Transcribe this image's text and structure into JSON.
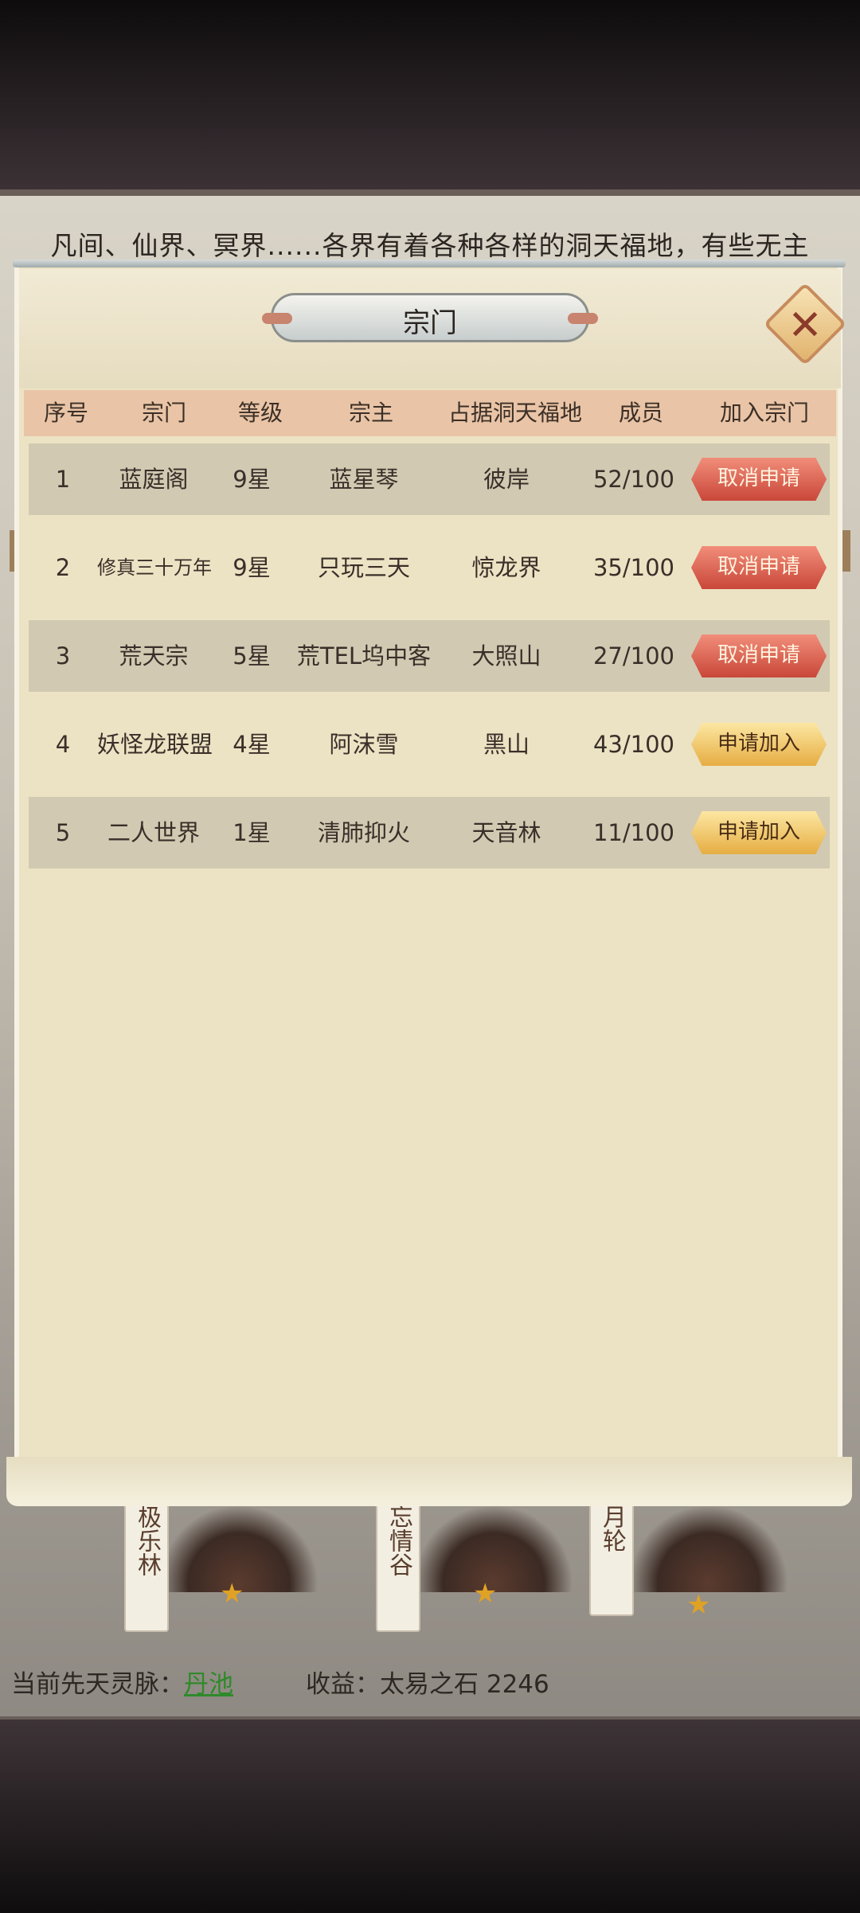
{
  "intro_text": "凡间、仙界、冥界......各界有着各种各样的洞天福地，有些无主",
  "dialog": {
    "title": "宗门",
    "close_icon": "close-icon",
    "columns": [
      "序号",
      "宗门",
      "等级",
      "宗主",
      "占据洞天福地",
      "成员",
      "加入宗门"
    ],
    "rows": [
      {
        "index": "1",
        "sect": "蓝庭阁",
        "level": "9星",
        "leader": "蓝星琴",
        "territory": "彼岸",
        "members": "52/100",
        "action": "取消申请",
        "action_type": "cancel"
      },
      {
        "index": "2",
        "sect": "修真三十万年",
        "level": "9星",
        "leader": "只玩三天",
        "territory": "惊龙界",
        "members": "35/100",
        "action": "取消申请",
        "action_type": "cancel"
      },
      {
        "index": "3",
        "sect": "荒天宗",
        "level": "5星",
        "leader": "荒TEL坞中客",
        "territory": "大照山",
        "members": "27/100",
        "action": "取消申请",
        "action_type": "cancel"
      },
      {
        "index": "4",
        "sect": "妖怪龙联盟",
        "level": "4星",
        "leader": "阿沫雪",
        "territory": "黑山",
        "members": "43/100",
        "action": "申请加入",
        "action_type": "apply"
      },
      {
        "index": "5",
        "sect": "二人世界",
        "level": "1星",
        "leader": "清肺抑火",
        "territory": "天音林",
        "members": "11/100",
        "action": "申请加入",
        "action_type": "apply"
      }
    ]
  },
  "locations": [
    {
      "name": "极乐林"
    },
    {
      "name": "忘情谷"
    },
    {
      "name": "月轮"
    }
  ],
  "footer": {
    "vein_label": "当前先天灵脉：",
    "vein_value": "丹池",
    "income_label": "收益：太易之石 2246"
  },
  "colors": {
    "cancel_button": "#d9574a",
    "apply_button": "#f0c35e",
    "header_row": "#e9c4a6",
    "panel": "#ece3c4"
  }
}
